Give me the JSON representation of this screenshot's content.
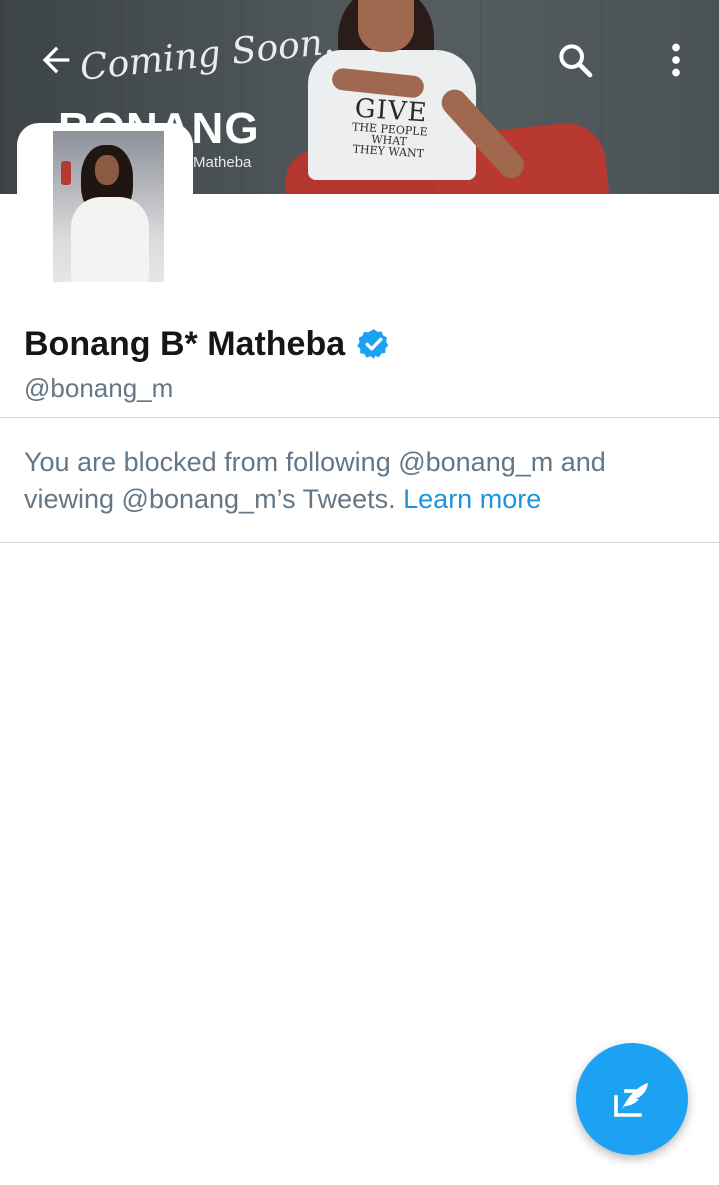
{
  "banner": {
    "tagline": "Coming Soon.",
    "name": "BONANG",
    "surname": "Matheba",
    "shirt_big": "GIVE",
    "shirt_small_1": "THE PEOPLE",
    "shirt_small_2": "WHAT",
    "shirt_small_3": "THEY WANT"
  },
  "toolbar": {
    "back_icon": "arrow-left-icon",
    "search_icon": "search-icon",
    "more_icon": "more-vertical-icon"
  },
  "profile": {
    "display_name": "Bonang B* Matheba",
    "verified": true,
    "handle": "@bonang_m"
  },
  "notice": {
    "text": "You are blocked from following @bonang_m and viewing @bonang_m’s Tweets.",
    "link_label": "Learn more"
  },
  "fab": {
    "icon": "compose-tweet-icon"
  },
  "colors": {
    "accent": "#1DA1F2",
    "link": "#1B95E0",
    "secondary_text": "#657786",
    "primary_text": "#14171A"
  }
}
